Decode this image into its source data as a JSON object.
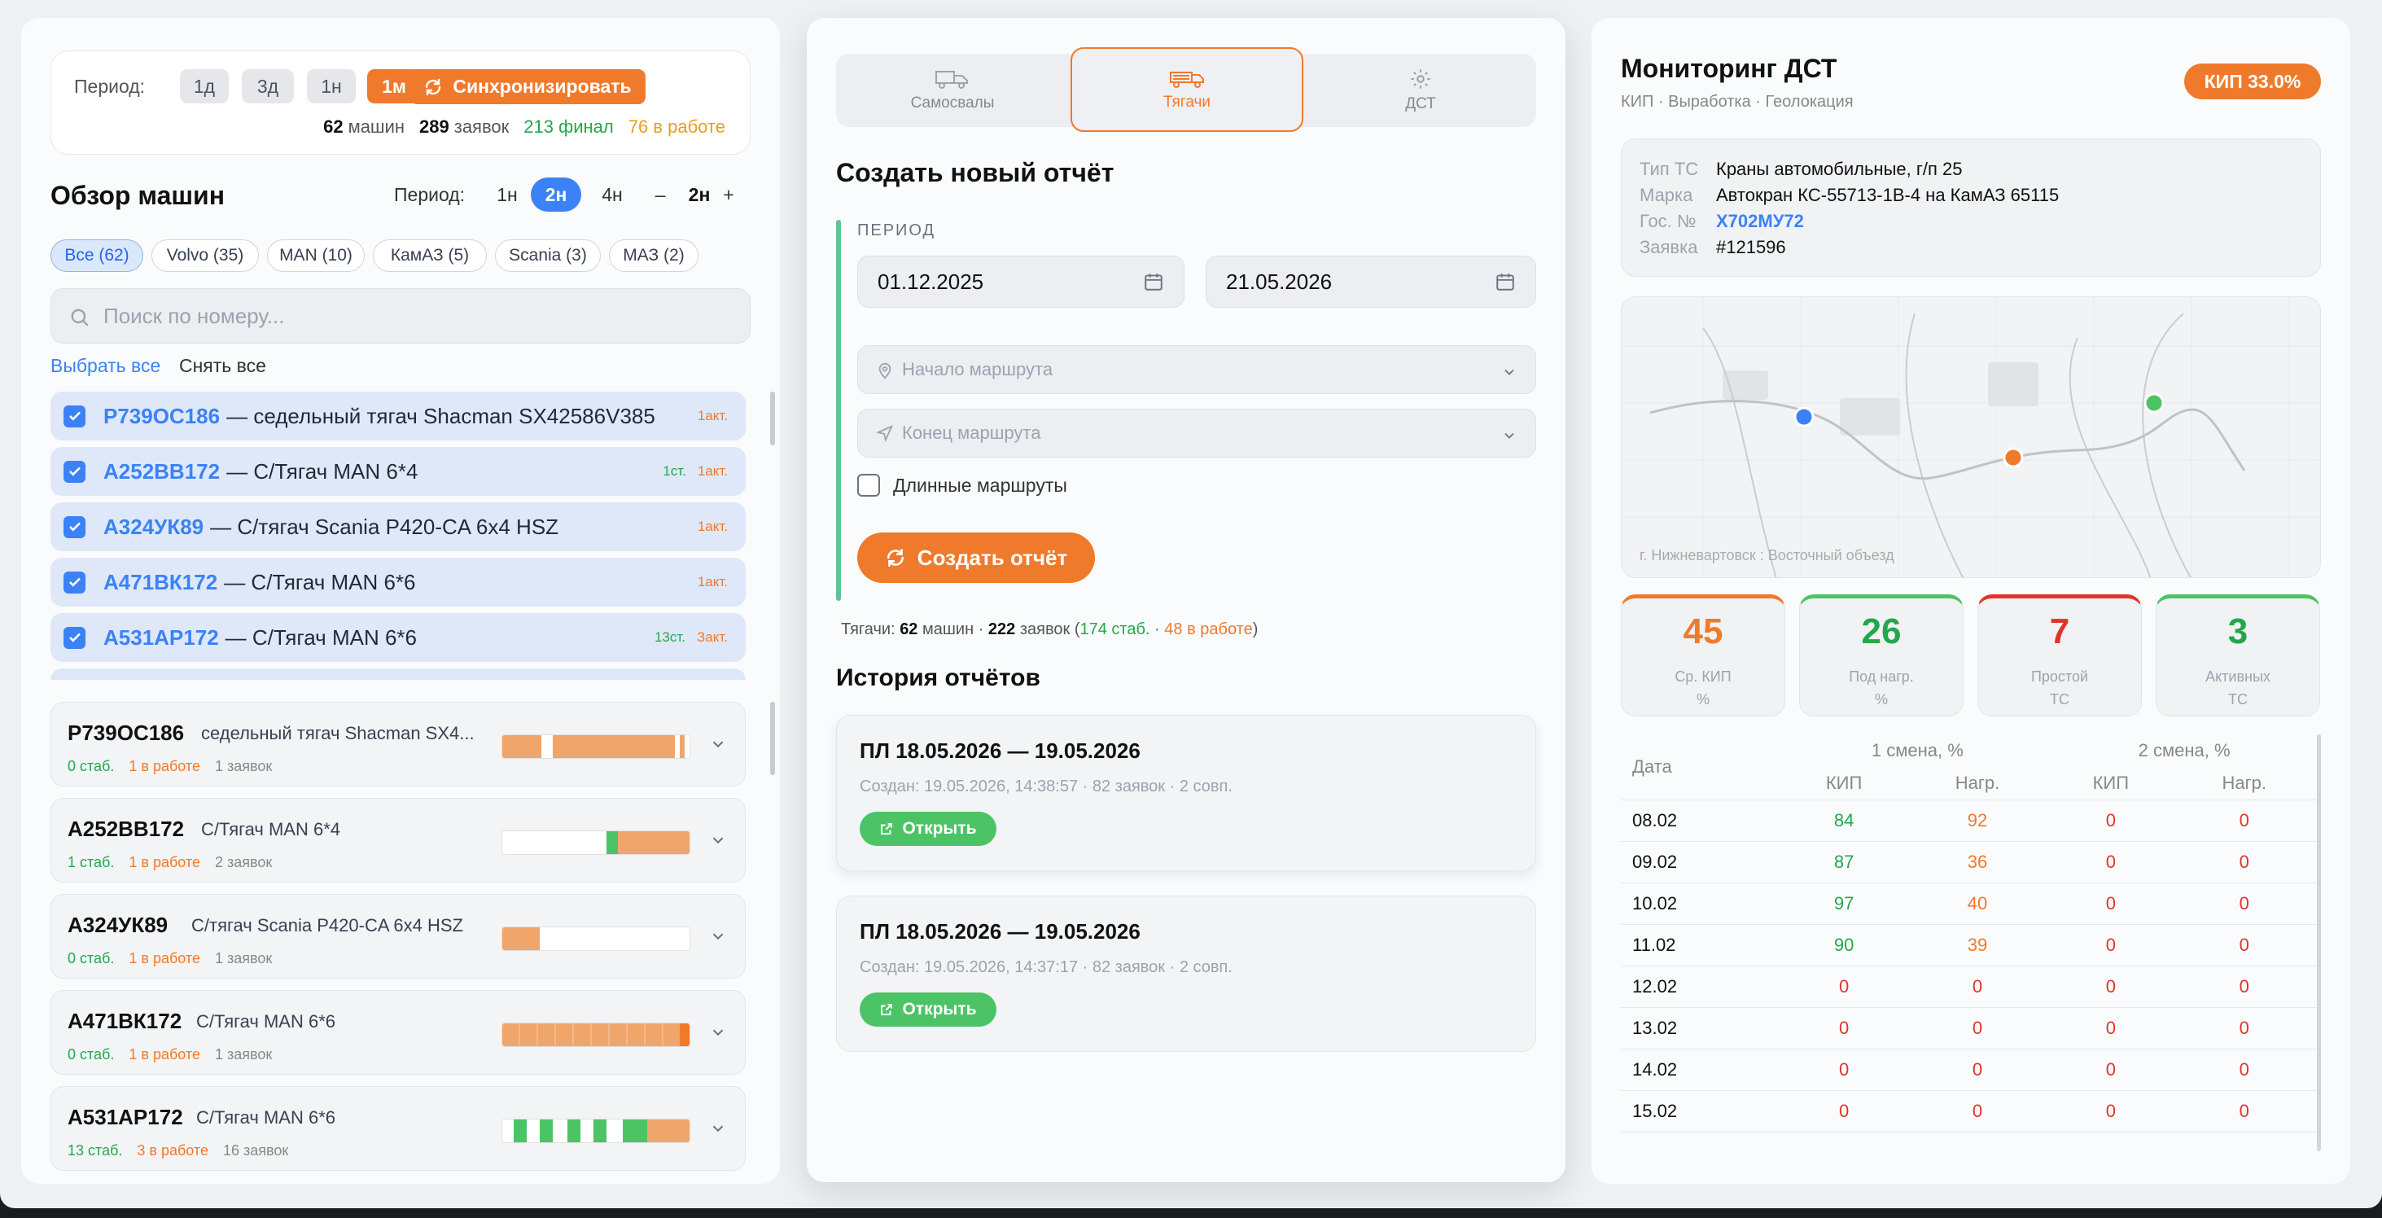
{
  "left": {
    "period_label": "Период:",
    "period_chips": [
      "1д",
      "3д",
      "1н",
      "1м"
    ],
    "sync_label": "Синхронизировать",
    "stats": {
      "cars_num": "62",
      "cars_label": "машин",
      "req_num": "289",
      "req_label": "заявок",
      "final": "213 финал",
      "work": "76 в работе"
    },
    "overview_title": "Обзор машин",
    "overview_period_label": "Период:",
    "overview_segments": [
      "1н",
      "2н",
      "4н"
    ],
    "stepper": {
      "minus": "–",
      "value": "2н",
      "plus": "+"
    },
    "filters": [
      "Все (62)",
      "Volvo (35)",
      "MAN (10)",
      "КамАЗ (5)",
      "Scania (3)",
      "МАЗ (2)"
    ],
    "search_placeholder": "Поиск по номеру...",
    "select_all": "Выбрать все",
    "deselect_all": "Снять все",
    "selected": [
      {
        "plate": "Р739ОС186",
        "desc": "— седельный тягач Shacman SX42586V385",
        "tag1": "",
        "tag2": "1акт."
      },
      {
        "plate": "А252ВВ172",
        "desc": "— С/Тягач MAN 6*4",
        "tag1": "1ст.",
        "tag2": "1акт."
      },
      {
        "plate": "А324УК89",
        "desc": "— С/тягач Scania P420-CA 6x4 HSZ",
        "tag1": "",
        "tag2": "1акт."
      },
      {
        "plate": "А471ВК172",
        "desc": "— С/Тягач MAN 6*6",
        "tag1": "",
        "tag2": "1акт."
      },
      {
        "plate": "А531АР172",
        "desc": "— С/Тягач MAN 6*6",
        "tag1": "13ст.",
        "tag2": "Закт."
      }
    ],
    "cards": [
      {
        "plate": "Р739ОС186",
        "desc": "седельный тягач Shacman SX4...",
        "stab": "0 стаб.",
        "work": "1 в работе",
        "req": "1 заявок"
      },
      {
        "plate": "А252ВВ172",
        "desc": "С/Тягач MAN 6*4",
        "stab": "1 стаб.",
        "work": "1 в работе",
        "req": "2 заявок"
      },
      {
        "plate": "А324УК89",
        "desc": "С/тягач Scania P420-CA 6x4 HSZ",
        "stab": "0 стаб.",
        "work": "1 в работе",
        "req": "1 заявок"
      },
      {
        "plate": "А471ВК172",
        "desc": "С/Тягач MAN 6*6",
        "stab": "0 стаб.",
        "work": "1 в работе",
        "req": "1 заявок"
      },
      {
        "plate": "А531АР172",
        "desc": "С/Тягач MAN 6*6",
        "stab": "13 стаб.",
        "work": "3 в работе",
        "req": "16 заявок"
      }
    ]
  },
  "mid": {
    "tabs": [
      "Самосвалы",
      "Тягачи",
      "ДСТ"
    ],
    "create_title": "Создать новый отчёт",
    "period_label": "ПЕРИОД",
    "date_from": "01.12.2025",
    "date_to": "21.05.2026",
    "route_start": "Начало маршрута",
    "route_end": "Конец маршрута",
    "long_routes": "Длинные маршруты",
    "create_btn": "Создать отчёт",
    "summary": {
      "prefix": "Тягачи:",
      "cars": "62",
      "cars_l": "машин ·",
      "req": "222",
      "req_l": "заявок (",
      "stab": "174 стаб.",
      "dot": "·",
      "work": "48 в работе",
      "close": ")"
    },
    "history_title": "История отчётов",
    "reports": [
      {
        "title": "ПЛ 18.05.2026 — 19.05.2026",
        "meta": "Создан: 19.05.2026, 14:38:57 · 82 заявок · 2 совп.",
        "open": "Открыть"
      },
      {
        "title": "ПЛ 18.05.2026 — 19.05.2026",
        "meta": "Создан: 19.05.2026, 14:37:17 · 82 заявок · 2 совп.",
        "open": "Открыть"
      }
    ]
  },
  "right": {
    "title": "Мониторинг ДСТ",
    "subtitle": "КИП · Выработка · Геолокация",
    "badge": "КИП 33.0%",
    "info": {
      "type_k": "Тип ТС",
      "type_v": "Краны автомобильные, г/п 25",
      "brand_k": "Марка",
      "brand_v": "Автокран КС-55713-1В-4 на КамАЗ 65115",
      "plate_k": "Гос. №",
      "plate_v": "Х702МУ72",
      "req_k": "Заявка",
      "req_v": "#121596"
    },
    "map_caption": "г. Нижневартовск : Восточный объезд",
    "kpis": [
      {
        "value": "45",
        "l1": "Ср. КИП",
        "l2": "%"
      },
      {
        "value": "26",
        "l1": "Под нагр.",
        "l2": "%"
      },
      {
        "value": "7",
        "l1": "Простой",
        "l2": "ТС"
      },
      {
        "value": "3",
        "l1": "Активных",
        "l2": "ТС"
      }
    ],
    "table": {
      "date_h": "Дата",
      "shift1": "1 смена, %",
      "shift2": "2 смена, %",
      "kip": "КИП",
      "load": "Нагр.",
      "rows": [
        {
          "d": "08.02",
          "a": "84",
          "b": "92",
          "c": "0",
          "e": "0"
        },
        {
          "d": "09.02",
          "a": "87",
          "b": "36",
          "c": "0",
          "e": "0"
        },
        {
          "d": "10.02",
          "a": "97",
          "b": "40",
          "c": "0",
          "e": "0"
        },
        {
          "d": "11.02",
          "a": "90",
          "b": "39",
          "c": "0",
          "e": "0"
        },
        {
          "d": "12.02",
          "a": "0",
          "b": "0",
          "c": "0",
          "e": "0"
        },
        {
          "d": "13.02",
          "a": "0",
          "b": "0",
          "c": "0",
          "e": "0"
        },
        {
          "d": "14.02",
          "a": "0",
          "b": "0",
          "c": "0",
          "e": "0"
        },
        {
          "d": "15.02",
          "a": "0",
          "b": "0",
          "c": "0",
          "e": "0"
        }
      ]
    }
  },
  "colors": {
    "accent": "#f07a2b",
    "blue": "#3b82f6",
    "green": "#22a84b",
    "red": "#e0342b"
  }
}
